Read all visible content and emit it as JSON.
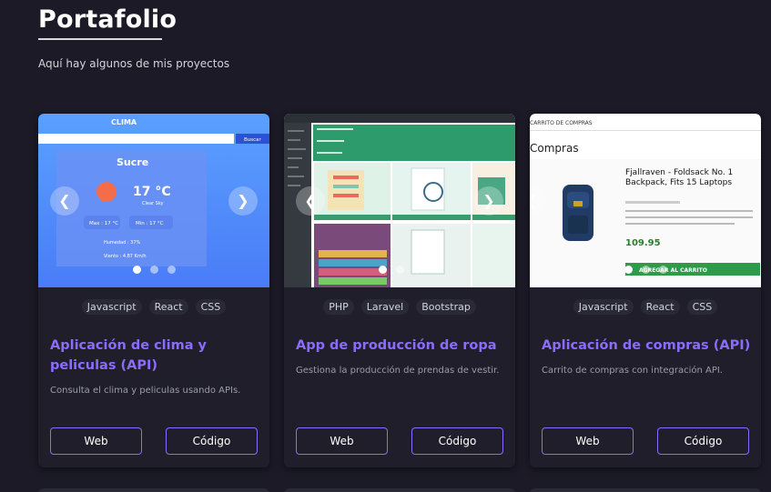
{
  "header": {
    "title": "Portafolio",
    "subtitle": "Aquí hay algunos de mis proyectos"
  },
  "projects": [
    {
      "tags": [
        "Javascript",
        "React",
        "CSS"
      ],
      "title": "Aplicación de clima y peliculas (API)",
      "description": "Consulta el clima y peliculas usando APIs.",
      "web_label": "Web",
      "code_label": "Código",
      "screenshot": {
        "app_title": "CLIMA",
        "search_button": "Buscar",
        "city": "Sucre",
        "temperature": "17 °C",
        "condition": "Clear Sky",
        "max": "Max : 17 °C",
        "min": "Min : 17 °C",
        "humidity": "Humedad : 37%",
        "wind": "Viento : 4.87 Km/h"
      }
    },
    {
      "tags": [
        "PHP",
        "Laravel",
        "Bootstrap"
      ],
      "title": "App de producción de ropa",
      "description": "Gestiona la producción de prendas de vestir.",
      "web_label": "Web",
      "code_label": "Código"
    },
    {
      "tags": [
        "Javascript",
        "React",
        "CSS"
      ],
      "title": "Aplicación de compras (API)",
      "description": "Carrito de compras con integración API.",
      "web_label": "Web",
      "code_label": "Código",
      "screenshot": {
        "header_text": "CARRITO DE COMPRAS",
        "page_title": "Compras",
        "product_name": "Fjallraven - Foldsack No. 1 Backpack, Fits 15 Laptops",
        "add_to_cart": "AGREGAR AL CARRITO",
        "price": "109.95"
      }
    }
  ],
  "colors": {
    "background": "#1b1a26",
    "card": "#1f1e2a",
    "accent": "#8b6cff"
  }
}
